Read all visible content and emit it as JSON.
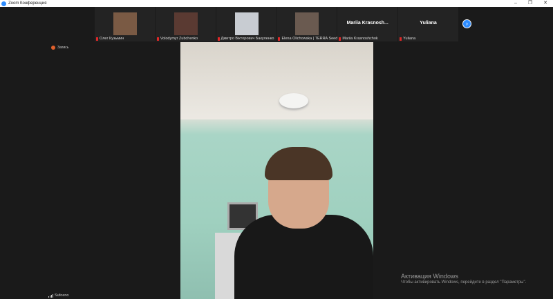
{
  "window": {
    "title": "Zoom Конференция",
    "minimize": "–",
    "restore": "❐",
    "close": "✕"
  },
  "participants": [
    {
      "name": "Олег Кузьмин",
      "has_video": true,
      "photo_color": "#7a5a44"
    },
    {
      "name": "Volodymyr Zubchenko",
      "has_video": true,
      "photo_color": "#5a3a32"
    },
    {
      "name": "Дмитро Вікторович Бакуленко",
      "has_video": true,
      "photo_color": "#c8ccd2"
    },
    {
      "name": "Elena Olichowska | TERRA Seed",
      "has_video": true,
      "photo_color": "#6a5a50"
    },
    {
      "name": "Mariia Krasnoshchok",
      "display": "Mariia  Krasnosh...",
      "has_video": false
    },
    {
      "name": "Yuliana",
      "display": "Yuliana",
      "has_video": false
    }
  ],
  "next_arrow": "›",
  "recording": {
    "label": "Запись"
  },
  "network": {
    "label": "Sufoeno"
  },
  "watermark": {
    "title": "Активация Windows",
    "subtitle": "Чтобы активировать Windows, перейдите в раздел \"Параметры\"."
  }
}
